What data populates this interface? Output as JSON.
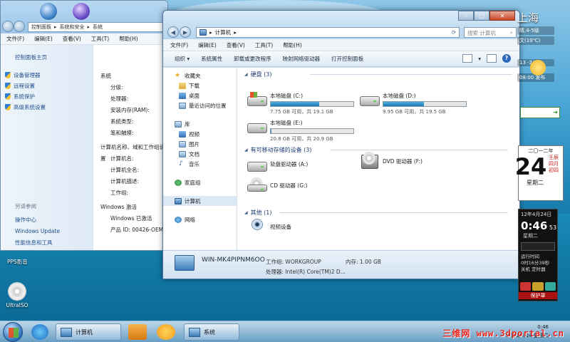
{
  "back_window": {
    "breadcrumb": [
      "控制面板",
      "系统和安全",
      "系统"
    ],
    "menu": [
      "文件(F)",
      "编辑(E)",
      "查看(V)",
      "工具(T)",
      "帮助(H)"
    ],
    "home_link": "控制面板主页",
    "links": [
      "设备管理器",
      "远程设置",
      "系统保护",
      "高级系统设置"
    ],
    "see_also_label": "另请参阅",
    "see_also": [
      "操作中心",
      "Windows Update",
      "性能信息和工具"
    ],
    "system_header": "系统",
    "system_rows": [
      "分级:",
      "处理器:",
      "安装内存(RAM):",
      "系统类型:",
      "笔和触摸:"
    ],
    "computer_header": "计算机名称、域和工作组设置",
    "computer_rows": [
      "计算机名:",
      "计算机全名:",
      "计算机描述:",
      "工作组:"
    ],
    "activation_header": "Windows 激活",
    "activation_status": "Windows 已激活",
    "product_id": "产品 ID: 00426-OEM"
  },
  "desktop_icons": [
    "PPS影音",
    "UltraISO"
  ],
  "window": {
    "address": "计算机",
    "search_placeholder": "搜索 计算机",
    "menu": [
      "文件(F)",
      "编辑(E)",
      "查看(V)",
      "工具(T)",
      "帮助(H)"
    ],
    "toolbar": [
      "组织 ▾",
      "系统属性",
      "卸载或更改程序",
      "映射网络驱动器",
      "打开控制面板"
    ],
    "nav": {
      "favorites": "收藏夹",
      "fav_items": [
        "下载",
        "桌面",
        "最近访问的位置"
      ],
      "libraries": "库",
      "lib_items": [
        "视频",
        "图片",
        "文档",
        "音乐"
      ],
      "homegroup": "家庭组",
      "computer": "计算机",
      "network": "网络"
    },
    "groups": {
      "hdd": "硬盘 (3)",
      "removable": "有可移动存储的设备 (3)",
      "other": "其他 (1)"
    },
    "drives": [
      {
        "name": "本地磁盘 (C:)",
        "info": "7.75 GB 可用，共 19.1 GB",
        "fill": 0.59
      },
      {
        "name": "本地磁盘 (D:)",
        "info": "9.95 GB 可用，共 19.5 GB",
        "fill": 0.49
      },
      {
        "name": "本地磁盘 (E:)",
        "info": "20.8 GB 可用，共 20.9 GB",
        "fill": 0.01
      }
    ],
    "removable": [
      "软盘驱动器 (A:)",
      "DVD 驱动器 (F:)",
      "CD 驱动器 (G:)"
    ],
    "other_items": [
      "视频设备"
    ],
    "details": {
      "name": "WIN-MK4PIPNM6OO",
      "workgroup": "工作组: WORKGROUP",
      "memory": "内存: 1.00 GB",
      "processor": "处理器: Intel(R) Core(TM)2 D..."
    }
  },
  "gadgets": {
    "city": "上海",
    "weather_line1": "晴,4-5级",
    "weather_line2": "文(19℃)",
    "weather_range": "13 -24℃",
    "weather_time": "08:00 发布",
    "cal_top": "二〇一二年",
    "cal_day": "24",
    "cal_lunar": "壬辰四月初四",
    "cal_weekday": "星期二",
    "clock_date": "12年4月24日",
    "clock_time": "0:46",
    "clock_sec": "53",
    "clock_weekday": "星期二",
    "clock_lines": [
      "运行时间",
      "0时16分39秒",
      "关机 定时器"
    ],
    "clock_footer": "保护罩"
  },
  "taskbar": {
    "tasks": [
      "计算机",
      "系统"
    ],
    "tray_time": "0:46",
    "tray_date": "2012/4/24 星期二",
    "watermark": "三维网 www.3dportal.cn"
  }
}
